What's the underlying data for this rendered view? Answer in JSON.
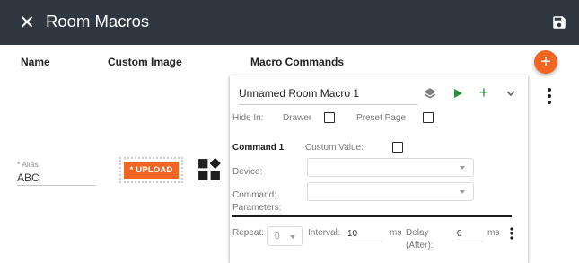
{
  "header": {
    "title": "Room Macros",
    "close_icon": "close-icon",
    "save_icon": "save-icon",
    "background": "#2f3740"
  },
  "columns": {
    "name": "Name",
    "custom_image": "Custom Image",
    "macro_commands": "Macro Commands"
  },
  "add_button_label": "+",
  "accent_color": "#f26522",
  "row": {
    "alias_label": "* Alias",
    "alias_value": "ABC",
    "upload_label": "* UPLOAD",
    "image_icon": "widgets-icon"
  },
  "macro": {
    "name": "Unnamed Room Macro 1",
    "hide_in_label": "Hide In:",
    "drawer_label": "Drawer",
    "drawer_checked": false,
    "preset_page_label": "Preset Page",
    "preset_page_checked": false,
    "command": {
      "title": "Command 1",
      "custom_value_label": "Custom Value:",
      "custom_value_checked": false,
      "device_label": "Device:",
      "device_value": "",
      "command_label_line1": "Command:",
      "command_label_line2": "Parameters:",
      "command_value": "",
      "repeat_label": "Repeat:",
      "repeat_value": "0",
      "interval_label": "Interval:",
      "interval_value": "10",
      "interval_unit": "ms",
      "delay_label_line1": "Delay",
      "delay_label_line2": "(After):",
      "delay_value": "0",
      "delay_unit": "ms"
    }
  }
}
